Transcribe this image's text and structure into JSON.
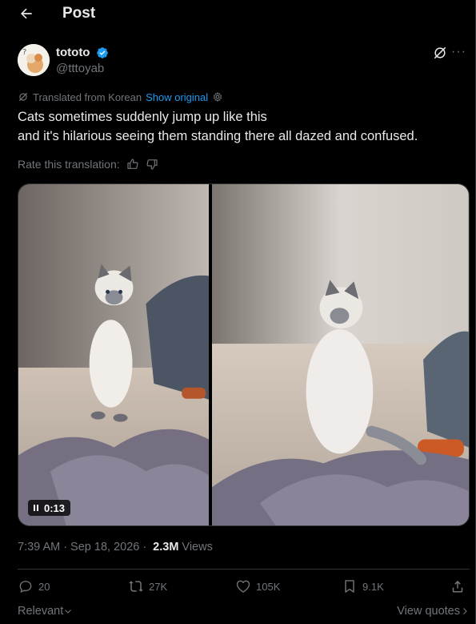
{
  "header": {
    "title": "Post",
    "back_icon": "arrow-left-icon"
  },
  "author": {
    "display_name": "tototo",
    "handle": "@tttoyab",
    "verified": true,
    "verified_color": "#1d9bf0"
  },
  "translation": {
    "label": "Translated from Korean",
    "show_original": "Show original",
    "rate_label": "Rate this translation:"
  },
  "post": {
    "line1": "Cats sometimes suddenly jump up like this",
    "line2": "and it's hilarious seeing them standing there all dazed and confused."
  },
  "media": {
    "video_duration": "0:13"
  },
  "meta": {
    "time": "7:39 AM",
    "date": "Sep 18, 2026",
    "views_count": "2.3M",
    "views_label": "Views"
  },
  "actions": {
    "replies": "20",
    "reposts": "27K",
    "likes": "105K",
    "bookmarks": "9.1K"
  },
  "footer": {
    "relevant": "Relevant",
    "view_quotes": "View quotes"
  },
  "colors": {
    "accent": "#1d9bf0",
    "muted": "#71767b",
    "text": "#e7e9ea",
    "background": "#000000",
    "border": "#2f3336"
  }
}
